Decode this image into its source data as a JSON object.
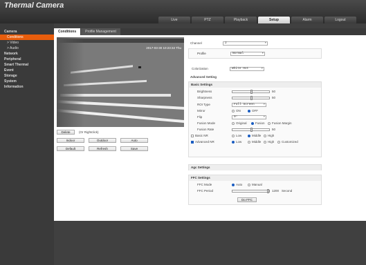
{
  "app": {
    "title": "Thermal Camera"
  },
  "nav": {
    "tabs": [
      "Live",
      "PTZ",
      "Playback",
      "Setup",
      "Alarm",
      "Logout"
    ],
    "active": "Setup"
  },
  "sidebar": {
    "items": [
      {
        "label": "Camera",
        "sub": false
      },
      {
        "label": "Conditions",
        "sub": true,
        "active": true
      },
      {
        "label": "> Video",
        "sub": true
      },
      {
        "label": "> Audio",
        "sub": true
      },
      {
        "label": "Network",
        "sub": false
      },
      {
        "label": "Peripheral",
        "sub": false
      },
      {
        "label": "Smart Thermal",
        "sub": false
      },
      {
        "label": "Event",
        "sub": false
      },
      {
        "label": "Storage",
        "sub": false
      },
      {
        "label": "System",
        "sub": false
      },
      {
        "label": "Information",
        "sub": false
      }
    ]
  },
  "subtabs": [
    "Conditions",
    "Profile Management"
  ],
  "video": {
    "timestamp": "2017-03-30 10:23:32 Thu",
    "delete_label": "Delete",
    "hint": "(Or Rightclick)",
    "buttons1": [
      "Indoor",
      "Outdoor",
      "Auto"
    ],
    "buttons2": [
      "Default",
      "Refresh",
      "Save"
    ]
  },
  "settings": {
    "channel_label": "Channel",
    "channel_value": "2",
    "profile_label": "Profile",
    "profile_value": "Normal",
    "colorization_label": "Colorization",
    "colorization_value": "White Hot",
    "advanced_label": "Advanced Setting",
    "basic_head": "Basic Settings",
    "brightness_label": "Brightness",
    "brightness_value": "50",
    "sharpness_label": "Sharpness",
    "sharpness_value": "50",
    "roi_label": "ROI Type",
    "roi_value": "Full Screen",
    "mirror_label": "Mirror",
    "mirror_on": "ON",
    "mirror_off": "OFF",
    "flip_label": "Flip",
    "flip_value": "0°",
    "fusion_mode_label": "Fusion Mode",
    "fusion_opts": [
      "Original",
      "Fusion",
      "Fusion Margin"
    ],
    "fusion_rate_label": "Fusion Rate",
    "fusion_rate_value": "50",
    "basic_nr_label": "Basic NR",
    "basic_nr_opts": [
      "Low",
      "Middle",
      "High"
    ],
    "adv_nr_label": "Advanced NR",
    "adv_nr_opts": [
      "Low",
      "Middle",
      "High",
      "Customized"
    ],
    "agc_head": "Agc Settings",
    "ffc_head": "FFC Settings",
    "ffc_mode_label": "FFC Mode",
    "ffc_mode_opts": [
      "Auto",
      "Manual"
    ],
    "ffc_period_label": "FFC Period",
    "ffc_period_value": "1200",
    "ffc_period_unit": "Second",
    "do_ffc_label": "Do FFC"
  }
}
